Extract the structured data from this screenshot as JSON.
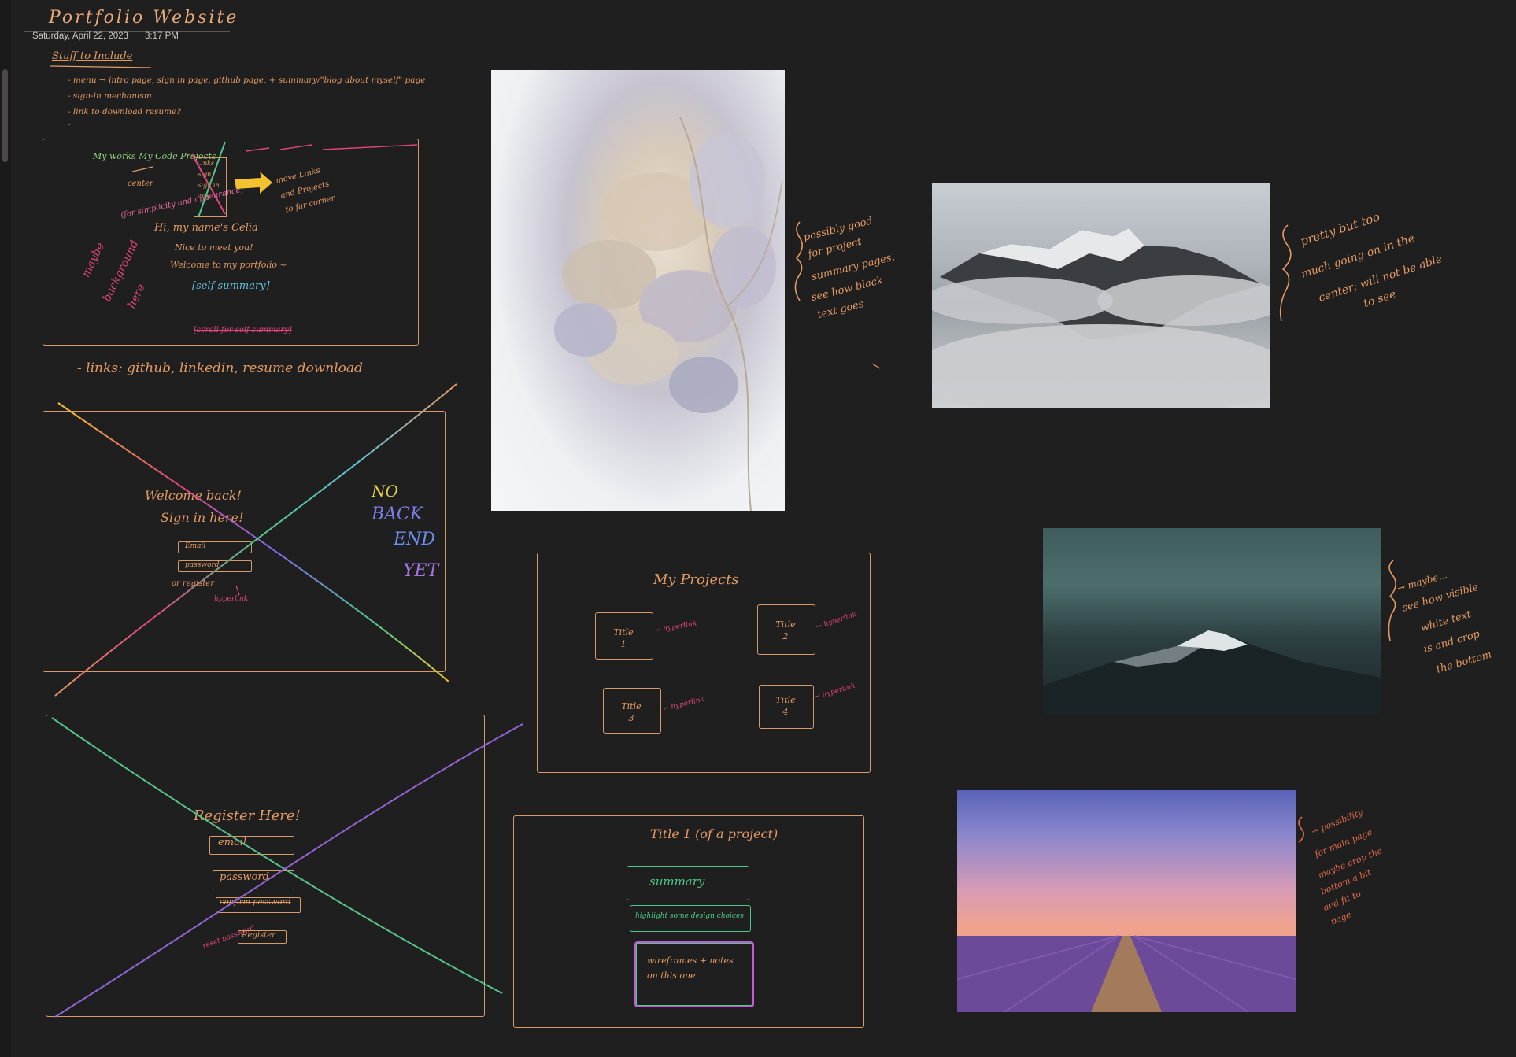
{
  "note": {
    "title": "Portfolio Website",
    "date": "Saturday, April 22, 2023",
    "time": "3:17 PM"
  },
  "stuff": {
    "heading": "Stuff to Include",
    "items": [
      "- menu → intro page, sign in page, github page, + summary/\"blog about myself\" page",
      "- sign-in mechanism",
      "- link to download resume?",
      "-"
    ]
  },
  "sketch1": {
    "nav_label": "My works My Code Projects",
    "center_note": "center",
    "simplicity_note": "(for simplicity and appearance)",
    "menu_words": [
      "Links",
      "Sign",
      "Sign in",
      "Proj"
    ],
    "more_note_lines": [
      "move Links",
      "and Projects",
      "to far corner"
    ],
    "side_note_lines": [
      "maybe",
      "background",
      "here"
    ],
    "greeting_lines": [
      "Hi, my name's Celia",
      "Nice to meet you!",
      "Welcome to my portfolio ~"
    ],
    "summary_label": "[self summary]",
    "scroll_note": "[scroll for self summary]"
  },
  "links_line": "- links: github, linkedin, resume download",
  "signin": {
    "lines": [
      "Welcome back!",
      "Sign in here!"
    ],
    "email_label": "Email",
    "password_label": "password",
    "register_label": "or register",
    "hyperlink_note": "hyperlink",
    "no_backend": [
      "NO",
      "BACK",
      "END",
      "YET"
    ]
  },
  "register": {
    "heading": "Register Here!",
    "email_label": "email",
    "password_label": "password",
    "confirm_label": "confirm password",
    "reset_label": "reset password",
    "register_button": "Register"
  },
  "projects": {
    "heading": "My Projects",
    "cards": [
      "Title\n1",
      "Title\n2",
      "Title\n3",
      "Title\n4"
    ],
    "hyperlink_note": "← hyperlink"
  },
  "project_detail": {
    "heading": "Title 1 (of a project)",
    "summary_label": "summary",
    "design_label": "highlight some design choices",
    "wireframe_label": "wireframes + notes on this one"
  },
  "photo_notes": {
    "flower": [
      "possibly good",
      "for project",
      "summary pages,",
      "see how black",
      "text goes"
    ],
    "cloud_mountain": [
      "pretty but too",
      "much going on in the",
      "center; will not be able",
      "to see"
    ],
    "teal_mountain": [
      "→ maybe...",
      "see how visible",
      "white text",
      "is and crop",
      "the bottom"
    ],
    "lavender": [
      "→ possibility",
      "for main page,",
      "maybe crop the",
      "bottom a bit",
      "and fit to",
      "page"
    ]
  },
  "colors": {
    "background": "#201f1f",
    "ink_orange": "#e39b64",
    "ink_pink": "#e0457d",
    "ink_yellow": "#f2c230",
    "ink_green": "#4ec98a"
  }
}
